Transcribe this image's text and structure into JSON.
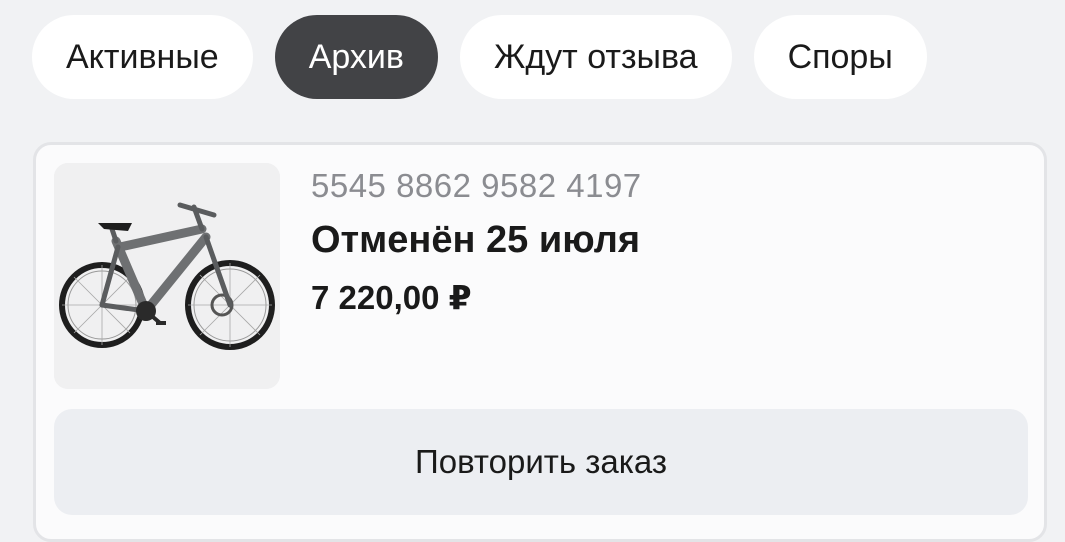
{
  "tabs": [
    {
      "label": "Активные",
      "active": false
    },
    {
      "label": "Архив",
      "active": true
    },
    {
      "label": "Ждут отзыва",
      "active": false
    },
    {
      "label": "Споры",
      "active": false
    }
  ],
  "order": {
    "number": "5545 8862 9582 4197",
    "status": "Отменён 25 июля",
    "price": "7 220,00 ₽",
    "product_icon": "bicycle-image",
    "repeat_label": "Повторить заказ"
  },
  "colors": {
    "active_tab_bg": "#424346",
    "tab_bg": "#ffffff",
    "page_bg": "#f1f2f4",
    "order_number_text": "#8b8c91",
    "button_bg": "#eceef2"
  }
}
